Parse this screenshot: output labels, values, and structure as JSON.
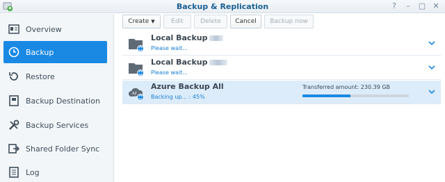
{
  "window": {
    "title": "Backup & Replication",
    "controls": [
      "help-icon",
      "pin-icon",
      "maximize-icon",
      "close-icon"
    ]
  },
  "sidebar": {
    "items": [
      {
        "label": "Overview",
        "icon": "overview-icon",
        "active": false
      },
      {
        "label": "Backup",
        "icon": "clock-backup-icon",
        "active": true
      },
      {
        "label": "Restore",
        "icon": "restore-icon",
        "active": false
      },
      {
        "label": "Backup Destination",
        "icon": "destination-icon",
        "active": false
      },
      {
        "label": "Backup Services",
        "icon": "tools-icon",
        "active": false
      },
      {
        "label": "Shared Folder Sync",
        "icon": "sync-icon",
        "active": false
      },
      {
        "label": "Log",
        "icon": "log-icon",
        "active": false
      }
    ]
  },
  "toolbar": {
    "create": "Create",
    "edit": "Edit",
    "delete": "Delete",
    "cancel": "Cancel",
    "backup_now": "Backup now"
  },
  "tasks": [
    {
      "name": "Local Backup",
      "status": "Please wait...",
      "icon": "folder-sync-icon"
    },
    {
      "name": "Local Backup",
      "status": "Please wait...",
      "icon": "folder-sync-icon"
    },
    {
      "name": "Azure Backup All",
      "status": "Backing up... : 45%",
      "icon": "azure-cloud-sync-icon",
      "transferred": "Transferred amount: 230.39 GB",
      "progress": 0.45
    }
  ],
  "colors": {
    "accent": "#1a89e4",
    "title": "#1b5f93",
    "selected_row": "#dcecfa"
  }
}
